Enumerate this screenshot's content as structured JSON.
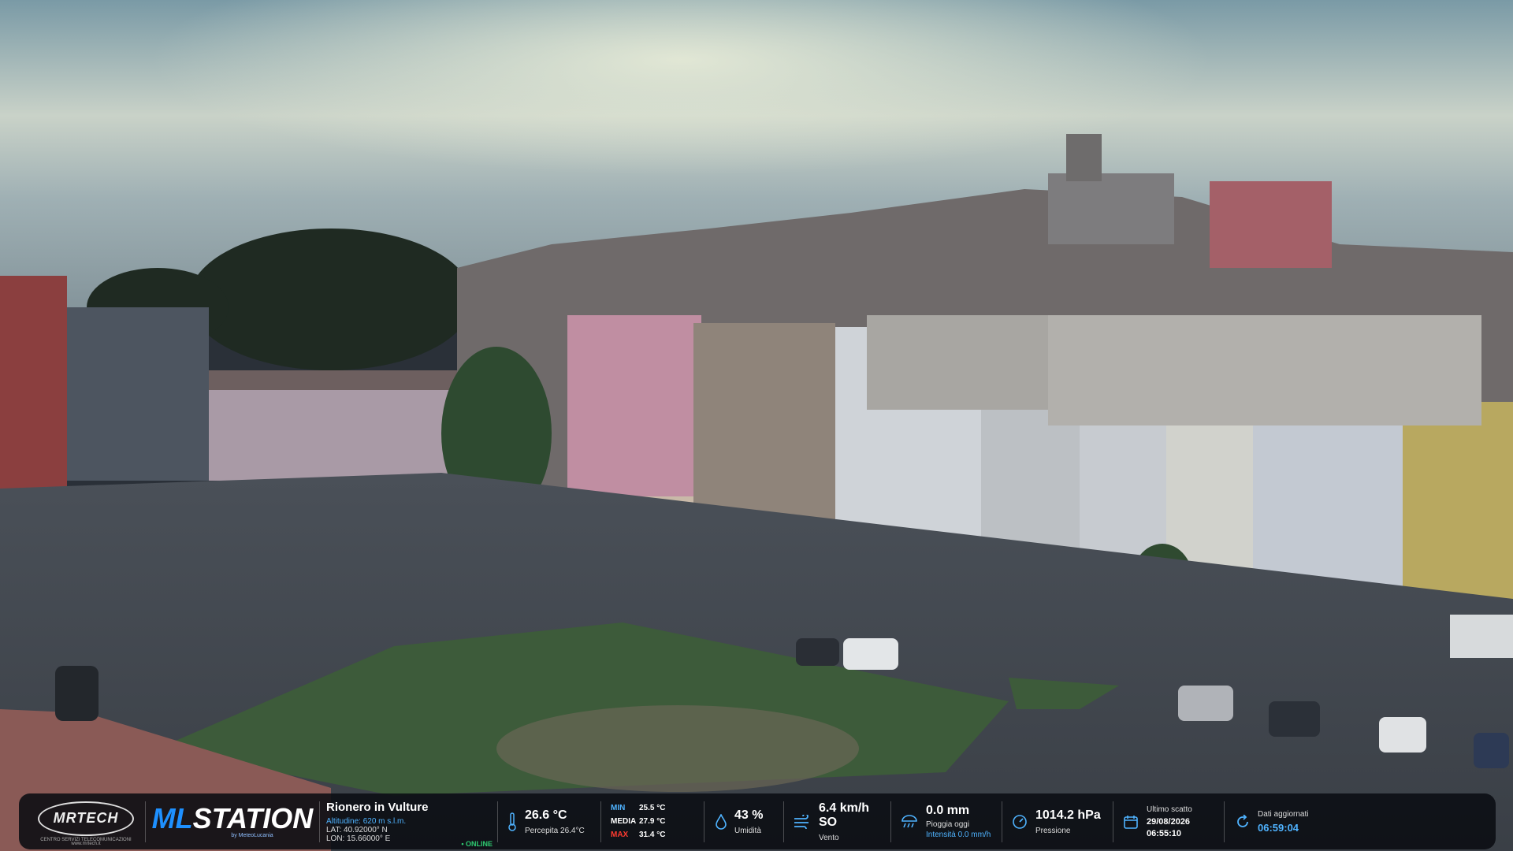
{
  "logos": {
    "mrtech_name": "MRTECH",
    "mrtech_tagline": "CENTRO SERVIZI TELECOMUNICAZIONI",
    "mrtech_url": "www.mrtech.it",
    "mlstation_prefix": "ML",
    "mlstation_suffix": "STATION",
    "mlstation_by": "by MeteoLucania"
  },
  "location": {
    "name": "Rionero in Vulture",
    "altitude": "Altitudine: 620 m s.l.m.",
    "lat": "LAT: 40.92000° N",
    "lon": "LON: 15.66000° E",
    "status": "• ONLINE"
  },
  "temperature": {
    "value": "26.6 °C",
    "perceived": "Percepita 26.4°C"
  },
  "minmax": {
    "min_label": "MIN",
    "min_value": "25.5 °C",
    "avg_label": "MEDIA",
    "avg_value": "27.9 °C",
    "max_label": "MAX",
    "max_value": "31.4 °C"
  },
  "humidity": {
    "value": "43 %",
    "label": "Umidità"
  },
  "wind": {
    "value": "6.4 km/h SO",
    "label": "Vento"
  },
  "rain": {
    "value": "0.0 mm",
    "label": "Pioggia oggi",
    "intensity": "Intensità 0.0 mm/h"
  },
  "pressure": {
    "value": "1014.2 hPa",
    "label": "Pressione"
  },
  "last_shot": {
    "label": "Ultimo scatto",
    "date": "29/08/2026",
    "time": "06:55:10"
  },
  "updated": {
    "label": "Dati aggiornati",
    "time": "06:59:04"
  },
  "colors": {
    "accent": "#4fb3ff",
    "min": "#4fb3ff",
    "max": "#ff3b30",
    "online": "#2ecc71"
  },
  "icons": {
    "temperature": "thermometer-icon",
    "humidity": "droplet-icon",
    "wind": "wind-icon",
    "rain": "rain-icon",
    "pressure": "gauge-icon",
    "last_shot": "calendar-icon",
    "updated": "refresh-icon"
  }
}
